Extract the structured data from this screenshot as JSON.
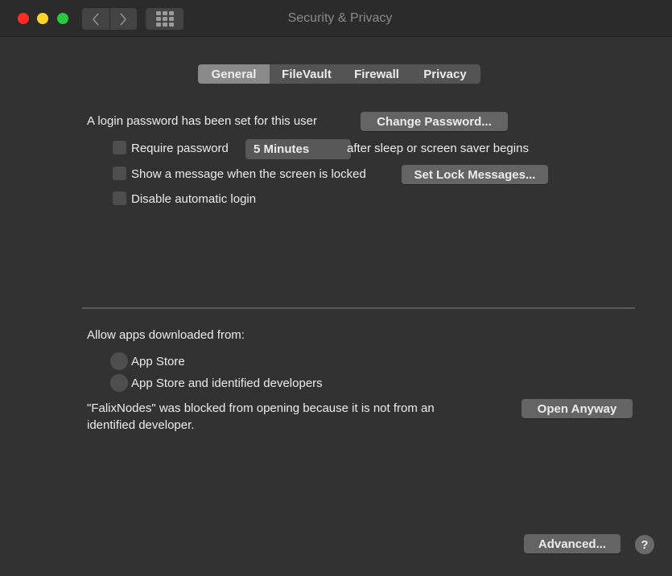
{
  "window": {
    "title": "Security & Privacy"
  },
  "tabs": [
    "General",
    "FileVault",
    "Firewall",
    "Privacy"
  ],
  "general": {
    "login_text": "A login password has been set for this user",
    "change_password_label": "Change Password...",
    "require_password_label": "Require password",
    "require_password_checked": false,
    "require_password_delay": "5 Minutes",
    "after_sleep_text": "after sleep or screen saver begins",
    "show_message_label": "Show a message when the screen is locked",
    "show_message_checked": false,
    "set_lock_messages_label": "Set Lock Messages...",
    "disable_auto_login_label": "Disable automatic login",
    "disable_auto_login_checked": false
  },
  "allow_apps": {
    "heading": "Allow apps downloaded from:",
    "options": [
      "App Store",
      "App Store and identified developers"
    ],
    "blocked_line1": "\"FalixNodes\" was blocked from opening because it is not from an",
    "blocked_line2": "identified developer.",
    "open_anyway_label": "Open Anyway"
  },
  "footer": {
    "advanced_label": "Advanced...",
    "help_label": "?"
  },
  "colors": {
    "close": "#fe2c26",
    "minimize": "#fed52a",
    "maximize": "#2bc93e"
  }
}
